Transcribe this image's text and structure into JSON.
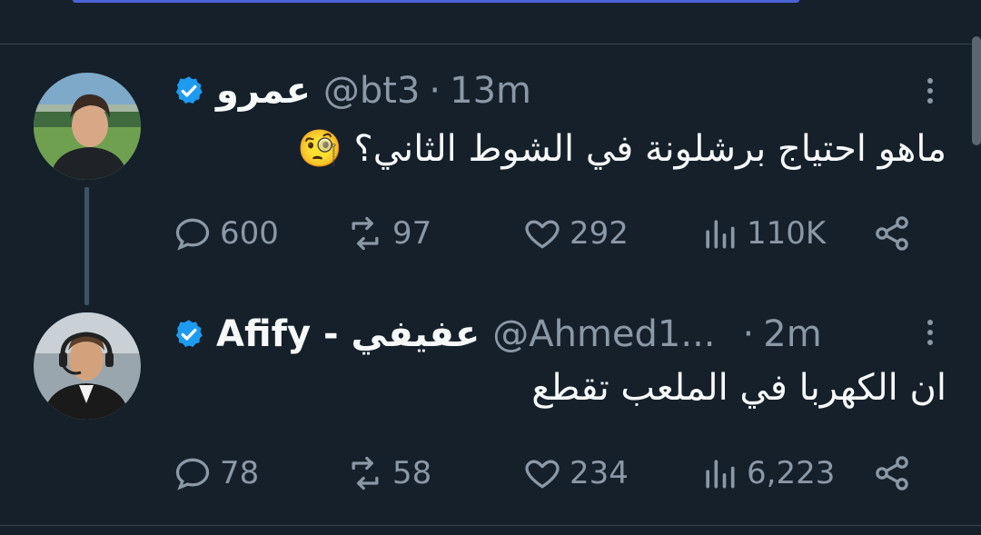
{
  "tweets": [
    {
      "display_name": "عمرو",
      "handle": "@bt3",
      "separator": "·",
      "time": "13m",
      "text": "ماهو احتياج برشلونة في الشوط الثاني؟ 🧐",
      "actions": {
        "replies": "600",
        "reposts": "97",
        "likes": "292",
        "views": "110K"
      },
      "verified": true
    },
    {
      "display_name": "Afify - عفيفي",
      "handle": "@Ahmed1...",
      "separator": "·",
      "time": "2m",
      "text": "ان الكهربا في الملعب تقطع",
      "actions": {
        "replies": "78",
        "reposts": "58",
        "likes": "234",
        "views": "6,223"
      },
      "verified": true
    }
  ],
  "colors": {
    "background": "#15202b",
    "text_primary": "#f7f9f9",
    "text_secondary": "#8b98a5",
    "verified_badge": "#1d9bf0",
    "divider": "#38444d"
  },
  "icons": [
    "verified-badge-icon",
    "more-options-icon",
    "reply-icon",
    "repost-icon",
    "like-icon",
    "views-icon",
    "share-icon"
  ]
}
